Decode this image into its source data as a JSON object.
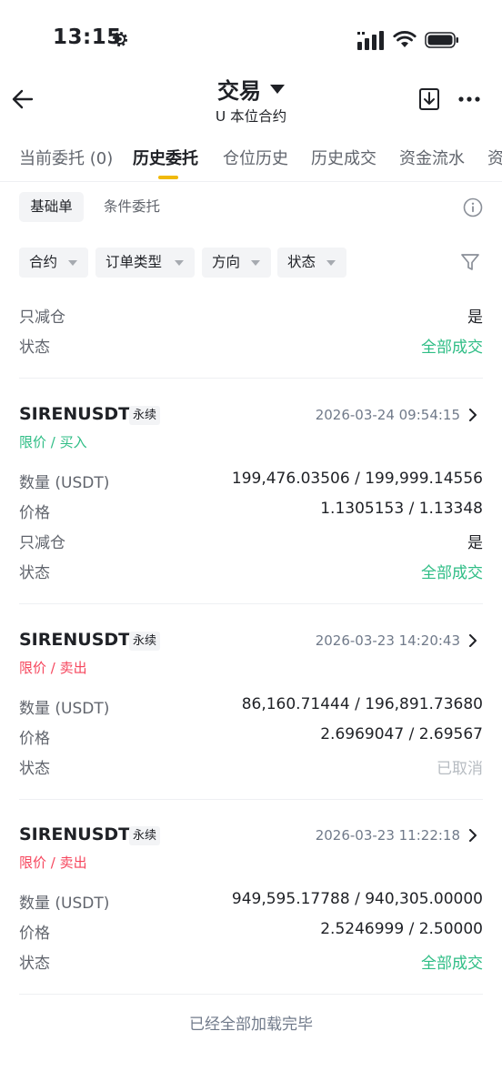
{
  "status_bar": {
    "time": "13:15"
  },
  "header": {
    "title": "交易",
    "subtitle": "U 本位合约"
  },
  "tabs": [
    {
      "label": "当前委托 (0)"
    },
    {
      "label": "历史委托"
    },
    {
      "label": "仓位历史"
    },
    {
      "label": "历史成交"
    },
    {
      "label": "资金流水"
    },
    {
      "label": "资"
    }
  ],
  "subtabs": {
    "basic": "基础单",
    "conditional": "条件委托"
  },
  "filters": [
    {
      "label": "合约"
    },
    {
      "label": "订单类型"
    },
    {
      "label": "方向"
    },
    {
      "label": "状态"
    }
  ],
  "partial_card": {
    "reduce_only_label": "只减仓",
    "reduce_only_value": "是",
    "status_label": "状态",
    "status_value": "全部成交"
  },
  "orders": [
    {
      "symbol": "SIRENUSDT",
      "badge": "永续",
      "time": "2026-03-24 09:54:15",
      "type": "限价 / 买入",
      "qty_label": "数量 (USDT)",
      "qty_value": "199,476.03506 / 199,999.14556",
      "price_label": "价格",
      "price_value": "1.1305153 / 1.13348",
      "reduce_label": "只减仓",
      "reduce_value": "是",
      "status_label": "状态",
      "status_value": "全部成交"
    },
    {
      "symbol": "SIRENUSDT",
      "badge": "永续",
      "time": "2026-03-23 14:20:43",
      "type": "限价 / 卖出",
      "qty_label": "数量 (USDT)",
      "qty_value": "86,160.71444 / 196,891.73680",
      "price_label": "价格",
      "price_value": "2.6969047 / 2.69567",
      "status_label": "状态",
      "status_value": "已取消"
    },
    {
      "symbol": "SIRENUSDT",
      "badge": "永续",
      "time": "2026-03-23 11:22:18",
      "type": "限价 / 卖出",
      "qty_label": "数量 (USDT)",
      "qty_value": "949,595.17788 / 940,305.00000",
      "price_label": "价格",
      "price_value": "2.5246999 / 2.50000",
      "status_label": "状态",
      "status_value": "全部成交"
    }
  ],
  "footer": {
    "text": "已经全部加载完毕"
  },
  "colors": {
    "accent": "#f0b90b",
    "buy": "#2ebd85",
    "sell": "#f6465d",
    "cancelled": "#b7bcc2"
  }
}
